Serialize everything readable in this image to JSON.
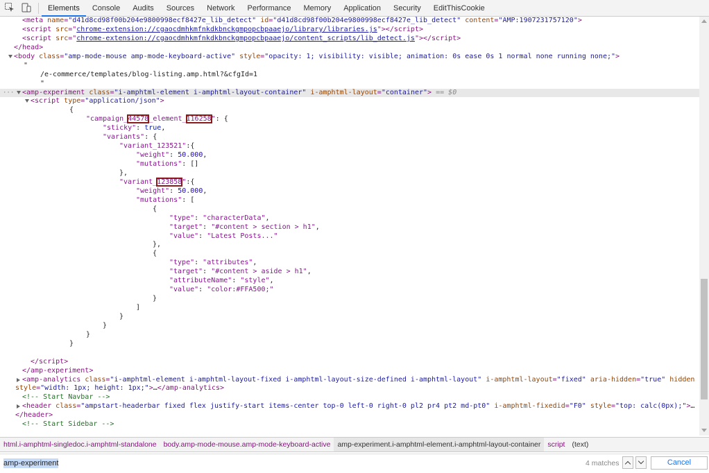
{
  "toolbar": {
    "icons": [
      "inspect-icon",
      "device-toggle-icon"
    ],
    "tabs": [
      "Elements",
      "Console",
      "Audits",
      "Sources",
      "Network",
      "Performance",
      "Memory",
      "Application",
      "Security",
      "EditThisCookie"
    ],
    "active_tab": "Elements"
  },
  "code": {
    "l1_attr_name": "name",
    "l1_attr_name_val": "\"d41d8cd98f00b204e9800998ecf8427e_lib_detect\"",
    "l1_attr_id": "id",
    "l1_attr_id_val": "\"d41d8cd98f00b204e9800998ecf8427e_lib_detect\"",
    "l1_attr_content": "content",
    "l1_attr_content_val": "\"AMP:1907231757120\"",
    "l2_src": "chrome-extension://cgaocdmhkmfnkdkbnckgmpopcbpaaejo/library/libraries.js",
    "l3_src": "chrome-extension://cgaocdmhkmfnkdkbnckgmpopcbpaaejo/content_scripts/lib_detect.js",
    "body_class": "\"amp-mode-mouse amp-mode-keyboard-active\"",
    "body_style": "\"opacity: 1; visibility: visible; animation: 0s ease 0s 1 normal none running none;\"",
    "quote": "\"",
    "text_url": "/e-commerce/templates/blog-listing.amp.html?&cfgId=1",
    "exp_class": "\"i-amphtml-element i-amphtml-layout-container\"",
    "exp_layout": "\"container\"",
    "eq0": "== $0",
    "script_type": "\"application/json\"",
    "json_campaign_pre": "\"campaign_",
    "json_campaign_id": "44578",
    "json_element_mid": "_element_",
    "json_element_id": "116258",
    "json_sticky_key": "\"sticky\"",
    "json_sticky_val": "true",
    "json_variants_key": "\"variants\"",
    "json_v1_key": "\"variant_123521\"",
    "json_weight_key": "\"weight\"",
    "json_weight_val": "50.000",
    "json_mutations_key": "\"mutations\"",
    "json_v2_pre": "\"variant_",
    "json_v2_id": "123858",
    "json_type_key": "\"type\"",
    "json_type1_val": "\"characterData\"",
    "json_target_key": "\"target\"",
    "json_target1_val": "\"#content > section > h1\"",
    "json_value_key": "\"value\"",
    "json_value1_val": "\"Latest Posts...\"",
    "json_type2_val": "\"attributes\"",
    "json_target2_val": "\"#content > aside > h1\"",
    "json_attrname_key": "\"attributeName\"",
    "json_attrname_val": "\"style\"",
    "json_value2_val": "\"color:#FFA500;\"",
    "analytics_class": "\"i-amphtml-element i-amphtml-layout-fixed i-amphtml-layout-size-defined i-amphtml-layout\"",
    "analytics_layout": "\"fixed\"",
    "analytics_hidden": "\"true\"",
    "analytics_style": "\"width: 1px; height: 1px;\"",
    "comment_navbar": "<!-- Start Navbar -->",
    "header_class": "\"ampstart-headerbar fixed flex justify-start items-center top-0 left-0 right-0 pl2 pr4 pt2 md-pt0\"",
    "header_fixedid": "\"F0\"",
    "header_style": "\"top: calc(0px);\"",
    "comment_sidebar": "<!-- Start Sidebar -->"
  },
  "breadcrumbs": [
    "html.i-amphtml-singledoc.i-amphtml-standalone",
    "body.amp-mode-mouse.amp-mode-keyboard-active",
    "amp-experiment.i-amphtml-element.i-amphtml-layout-container",
    "script",
    "(text)"
  ],
  "search": {
    "value": "amp-experiment",
    "matches": "4 matches",
    "cancel_label": "Cancel"
  }
}
